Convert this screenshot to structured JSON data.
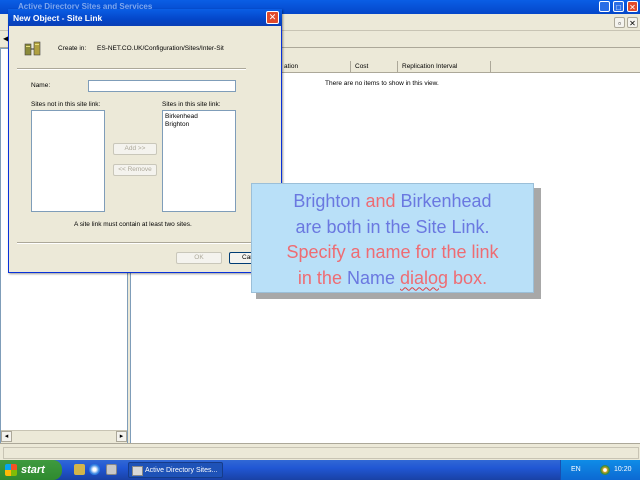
{
  "background_window": {
    "title": "Active Directory Sites and Services",
    "list_columns": [
      "ation",
      "Cost",
      "Replication Interval"
    ],
    "empty_message": "There are no items to show in this view."
  },
  "dialog": {
    "title": "New Object - Site Link",
    "close_glyph": "✕",
    "create_in_label": "Create in:",
    "create_in_path": "ES-NET.CO.UK/Configuration/Sites/Inter-Sit",
    "name_label": "Name:",
    "name_value": "",
    "sites_not_in_label": "Sites not in this site link:",
    "sites_in_label": "Sites in this site link:",
    "sites_not_in": [],
    "sites_in": [
      "Birkenhead",
      "Brighton"
    ],
    "add_button": "Add >>",
    "remove_button": "<< Remove",
    "hint": "A site link must contain at least two sites.",
    "ok_button": "OK",
    "cancel_button": "Cancel"
  },
  "callout": {
    "line1_a": "Brighton",
    "line1_b": " and ",
    "line1_c": "Birkenhead",
    "line2": "are both in the Site Link.",
    "line3": "Specify a name for the link",
    "line4_a": "in the ",
    "line4_b": "Name",
    "line4_c": " ",
    "line4_d": "dialog",
    "line4_e": " box."
  },
  "taskbar": {
    "start_label": "start",
    "task_label": "Active Directory Sites...",
    "language": "EN",
    "clock": "10:20"
  },
  "colors": {
    "callout_bg": "#b9e0f8",
    "callout_blue": "#6a78e0",
    "callout_pink": "#ee6c73",
    "xp_title_blue": "#0446c9"
  }
}
